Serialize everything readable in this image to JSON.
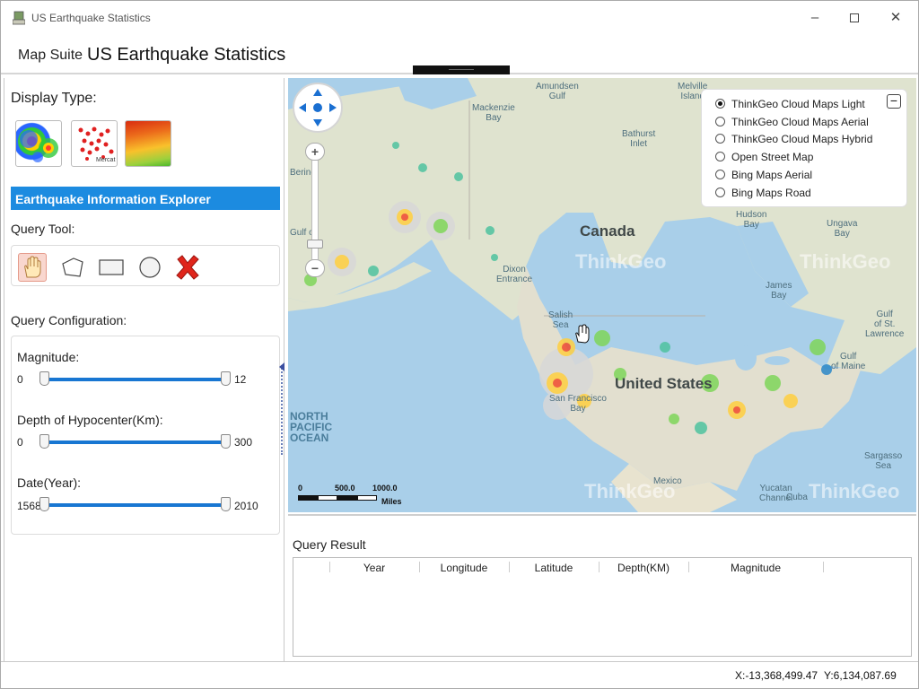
{
  "window": {
    "title": "US Earthquake Statistics"
  },
  "header": {
    "prefix": "Map Suite",
    "title": "US Earthquake Statistics"
  },
  "left_panel": {
    "display_type_label": "Display Type:",
    "display_types": [
      "heat-map",
      "point-map",
      "isoline-map"
    ],
    "thumb2_caption": "Mercat",
    "explorer_title": "Earthquake Information Explorer",
    "query_tool_label": "Query Tool:",
    "tools": [
      "pan-hand",
      "polygon",
      "rectangle",
      "circle",
      "clear"
    ],
    "query_config_label": "Query Configuration:",
    "sliders": [
      {
        "label": "Magnitude:",
        "min": "0",
        "max": "12"
      },
      {
        "label": "Depth of Hypocenter(Km):",
        "min": "0",
        "max": "300"
      },
      {
        "label": "Date(Year):",
        "min": "1568",
        "max": "2010"
      }
    ]
  },
  "map": {
    "labels": {
      "canada": "Canada",
      "us": "United States",
      "ocean": "NORTH\nPACIFIC\nOCEAN",
      "amundsen": "Amundsen\nGulf",
      "melville": "Melville\nIsland",
      "mackenzie": "Mackenzie\nBay",
      "bathurst": "Bathurst\nInlet",
      "hudson": "Hudson\nBay",
      "ungava": "Ungava\nBay",
      "james": "James\nBay",
      "gulf_st": "Gulf\nof St.\nLawrence",
      "gulf_maine": "Gulf\nof Maine",
      "sargasso": "Sargasso\nSea",
      "mexico": "Mexico",
      "yucatan": "Yucatan\nChannel",
      "cuba": "Cuba",
      "dixon": "Dixon\nEntrance",
      "salish": "Salish\nSea",
      "sf": "San Francisco\nBay",
      "bering": "Bering",
      "gulfof": "Gulf of",
      "watermark": "ThinkGeo"
    },
    "layers": [
      {
        "label": "ThinkGeo Cloud Maps Light",
        "selected": true
      },
      {
        "label": "ThinkGeo Cloud Maps Aerial",
        "selected": false
      },
      {
        "label": "ThinkGeo Cloud Maps Hybrid",
        "selected": false
      },
      {
        "label": "Open Street Map",
        "selected": false
      },
      {
        "label": "Bing Maps Aerial",
        "selected": false
      },
      {
        "label": "Bing Maps Road",
        "selected": false
      }
    ],
    "collapse_symbol": "−",
    "scale": {
      "zero": "0",
      "mid": "500.0",
      "max": "1000.0",
      "unit": "Miles"
    }
  },
  "results": {
    "title": "Query Result",
    "columns": [
      "Year",
      "Longitude",
      "Latitude",
      "Depth(KM)",
      "Magnitude"
    ],
    "rows": []
  },
  "status": {
    "x": "X:-13,368,499.47",
    "y": "Y:6,134,087.69"
  },
  "colors": {
    "accent": "#1c8be0",
    "slider": "#1876d2",
    "water": "#a9cfe9",
    "land": "#d9e0c8"
  }
}
